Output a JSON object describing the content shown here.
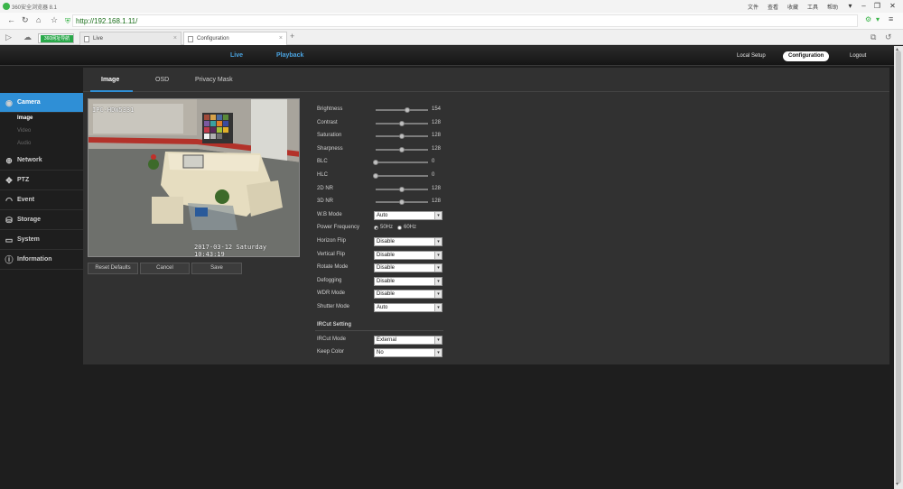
{
  "browser": {
    "window_title": "360安全浏览器 8.1",
    "menu": [
      "文件",
      "查看",
      "收藏",
      "工具",
      "帮助"
    ],
    "url": "http://192.168.1.11/",
    "bookmark_label": "360网址导航",
    "tabs": [
      {
        "label": "Live",
        "active": false
      },
      {
        "label": "Configuration",
        "active": true
      }
    ]
  },
  "topnav": {
    "live": "Live",
    "playback": "Playback",
    "local_setup": "Local Setup",
    "configuration": "Configuration",
    "logout": "Logout"
  },
  "sidebar": {
    "items": [
      {
        "label": "Camera",
        "icon": "camera-icon",
        "active": true,
        "subitems": [
          {
            "label": "Image",
            "active": true
          },
          {
            "label": "Video",
            "active": false
          },
          {
            "label": "Audio",
            "active": false
          }
        ]
      },
      {
        "label": "Network",
        "icon": "globe-icon",
        "active": false
      },
      {
        "label": "PTZ",
        "icon": "ptz-icon",
        "active": false
      },
      {
        "label": "Event",
        "icon": "event-icon",
        "active": false
      },
      {
        "label": "Storage",
        "icon": "storage-icon",
        "active": false
      },
      {
        "label": "System",
        "icon": "monitor-icon",
        "active": false
      },
      {
        "label": "Information",
        "icon": "info-icon",
        "active": false
      }
    ]
  },
  "panel_tabs": [
    {
      "label": "Image",
      "active": true
    },
    {
      "label": "OSD",
      "active": false
    },
    {
      "label": "Privacy Mask",
      "active": false
    }
  ],
  "video": {
    "osd_top": "IPC-HDW5331",
    "osd_time": "2017-03-12 Saturday 10:43:19"
  },
  "buttons": {
    "reset": "Reset Defaults",
    "cancel": "Cancel",
    "save": "Save"
  },
  "sliders": [
    {
      "label": "Brightness",
      "value": 154,
      "max": 255
    },
    {
      "label": "Contrast",
      "value": 128,
      "max": 255
    },
    {
      "label": "Saturation",
      "value": 128,
      "max": 255
    },
    {
      "label": "Sharpness",
      "value": 128,
      "max": 255
    },
    {
      "label": "BLC",
      "value": 0,
      "max": 255
    },
    {
      "label": "HLC",
      "value": 0,
      "max": 255
    },
    {
      "label": "2D NR",
      "value": 128,
      "max": 255
    },
    {
      "label": "3D NR",
      "value": 128,
      "max": 255
    }
  ],
  "wb_mode": {
    "label": "W.B Mode",
    "value": "Auto"
  },
  "power_frequency": {
    "label": "Power Frequency",
    "options": [
      "50Hz",
      "60Hz"
    ],
    "selected": "50Hz"
  },
  "selects": [
    {
      "label": "Horizon Flip",
      "value": "Disable"
    },
    {
      "label": "Vertical Flip",
      "value": "Disable"
    },
    {
      "label": "Rotate Mode",
      "value": "Disable"
    },
    {
      "label": "Defogging",
      "value": "Disable"
    },
    {
      "label": "WDR Mode",
      "value": "Disable"
    },
    {
      "label": "Shutter Mode",
      "value": "Auto"
    }
  ],
  "ircut": {
    "section_title": "IRCut Setting",
    "mode": {
      "label": "IRCut Mode",
      "value": "External"
    },
    "keep_color": {
      "label": "Keep Color",
      "value": "No"
    }
  },
  "colors": {
    "accent": "#2f8fd6",
    "panel": "#313131",
    "background": "#1e1e1e"
  }
}
